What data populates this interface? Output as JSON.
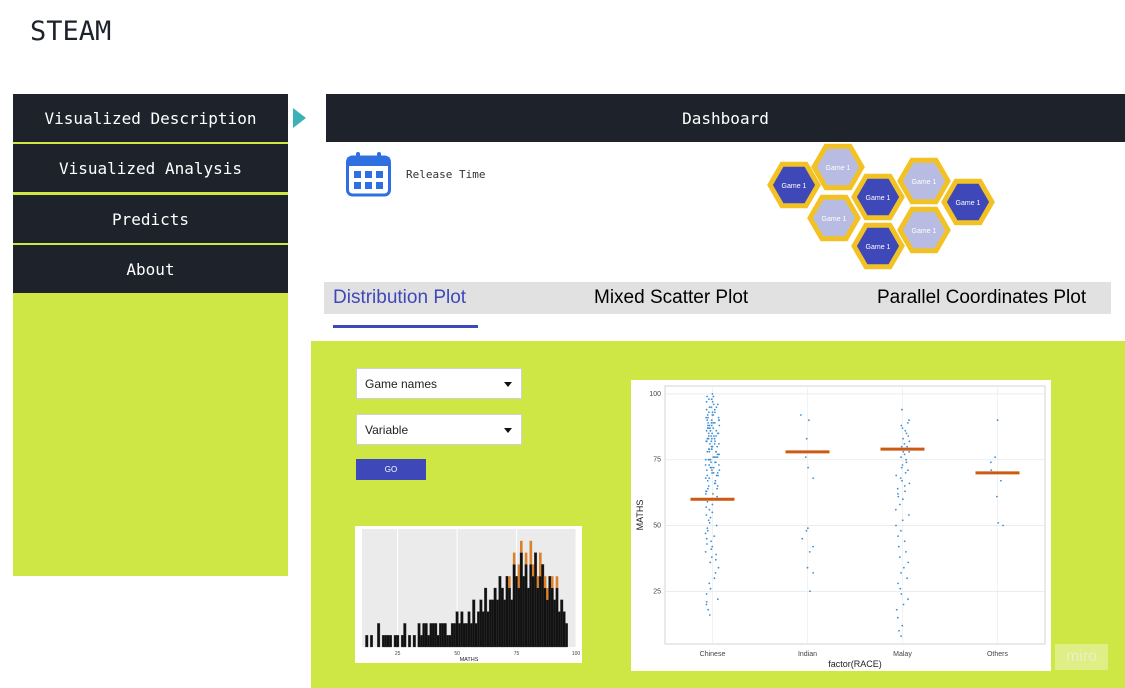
{
  "app": {
    "title": "STEAM"
  },
  "sidebar": {
    "items": [
      {
        "label": "Visualized Description"
      },
      {
        "label": "Visualized Analysis"
      },
      {
        "label": "Predicts"
      },
      {
        "label": "About"
      }
    ]
  },
  "dashboard": {
    "title": "Dashboard",
    "release_label": "Release Time",
    "calendar_icon": "calendar-icon",
    "hex_label": "Game 1",
    "hex_colors": {
      "dark": "#3f48b8",
      "light": "#b8bce2",
      "border": "#f2c225"
    }
  },
  "tabs": [
    {
      "label": "Distribution Plot",
      "active": true
    },
    {
      "label": "Mixed Scatter Plot",
      "active": false
    },
    {
      "label": "Parallel Coordinates Plot",
      "active": false
    }
  ],
  "controls": {
    "game_select": {
      "value": "Game names"
    },
    "variable_select": {
      "value": "Variable"
    },
    "go_label": "GO"
  },
  "watermark": "miro",
  "colors": {
    "accent_green": "#cfe744",
    "nav_dark": "#1e222b",
    "accent_blue": "#3f48b8",
    "arrow_teal": "#3ab2b8"
  },
  "chart_data": [
    {
      "type": "bar",
      "xlabel": "MATHS",
      "xticks": [
        25,
        50,
        75,
        100
      ],
      "xlim": [
        10,
        100
      ],
      "x": [
        12,
        14,
        17,
        19,
        20,
        21,
        22,
        24,
        25,
        27,
        28,
        30,
        32,
        34,
        35,
        36,
        37,
        38,
        39,
        40,
        41,
        42,
        43,
        44,
        45,
        46,
        47,
        48,
        49,
        50,
        51,
        52,
        53,
        54,
        55,
        56,
        57,
        58,
        59,
        60,
        61,
        62,
        63,
        64,
        65,
        66,
        67,
        68,
        69,
        70,
        71,
        72,
        73,
        74,
        75,
        76,
        77,
        78,
        79,
        80,
        81,
        82,
        83,
        84,
        85,
        86,
        87,
        88,
        89,
        90,
        91,
        92,
        93,
        94,
        95,
        96
      ],
      "series": [
        {
          "values": [
            1,
            1,
            2,
            1,
            1,
            1,
            1,
            1,
            1,
            1,
            2,
            1,
            1,
            2,
            1,
            2,
            2,
            1,
            2,
            2,
            2,
            1,
            2,
            2,
            2,
            1,
            1,
            2,
            2,
            3,
            2,
            3,
            2,
            2,
            3,
            2,
            4,
            2,
            3,
            4,
            3,
            5,
            3,
            4,
            4,
            5,
            4,
            6,
            5,
            4,
            6,
            5,
            4,
            7,
            6,
            5,
            8,
            6,
            7,
            5,
            7,
            6,
            8,
            5,
            6,
            7,
            5,
            4,
            6,
            5,
            4,
            5,
            3,
            4,
            3,
            2
          ]
        },
        {
          "values": [
            0,
            0,
            0,
            0,
            0,
            0,
            0,
            0,
            0,
            0,
            0,
            0,
            0,
            0,
            0,
            0,
            0,
            0,
            0,
            0,
            0,
            0,
            0,
            0,
            0,
            0,
            0,
            0,
            0,
            0,
            0,
            0,
            0,
            0,
            0,
            0,
            0,
            0,
            0,
            0,
            0,
            0,
            0,
            0,
            0,
            0,
            0,
            0,
            0,
            0,
            0,
            1,
            0,
            1,
            0,
            2,
            1,
            0,
            1,
            0,
            2,
            1,
            0,
            1,
            2,
            0,
            1,
            1,
            0,
            1,
            0,
            1,
            0,
            0,
            0,
            0
          ]
        }
      ]
    },
    {
      "type": "scatter",
      "xlabel": "factor(RACE)",
      "ylabel": "MATHS",
      "categories": [
        "Chinese",
        "Indian",
        "Malay",
        "Others"
      ],
      "yticks": [
        25,
        50,
        75,
        100
      ],
      "ylim": [
        5,
        103
      ],
      "category_means": [
        60,
        78,
        79,
        70
      ],
      "points": [
        [
          [
            100,
            99,
            99,
            98,
            98,
            97,
            97,
            96,
            96,
            95,
            95,
            95,
            94,
            94,
            93,
            93,
            93,
            92,
            92,
            92,
            91,
            91,
            91,
            90,
            90,
            90,
            90,
            89,
            89,
            89,
            89,
            88,
            88,
            88,
            88,
            87,
            87,
            87,
            87,
            86,
            86,
            86,
            86,
            85,
            85,
            85,
            85,
            84,
            84,
            84,
            84,
            83,
            83,
            83,
            83,
            82,
            82,
            82,
            82,
            81,
            81,
            81,
            80,
            80,
            80,
            80,
            79,
            79,
            79,
            79,
            78,
            78,
            78,
            78,
            77,
            77,
            77,
            76,
            76,
            76,
            76,
            75,
            75,
            75,
            75,
            74,
            74,
            74,
            73,
            73,
            73,
            72,
            72,
            72,
            71,
            71,
            71,
            70,
            70,
            70,
            69,
            69,
            69,
            68,
            68,
            67,
            67,
            66,
            66,
            65,
            65,
            64,
            64,
            63,
            63,
            62,
            62,
            61,
            60,
            59,
            58,
            57,
            56,
            55,
            54,
            53,
            52,
            51,
            50,
            49,
            48,
            47,
            46,
            45,
            44,
            43,
            42,
            41,
            40,
            39,
            38,
            37,
            36,
            34,
            32,
            30,
            28,
            26,
            24,
            22,
            21,
            20,
            18,
            16
          ]
        ],
        [
          [
            92,
            90,
            83,
            76,
            72,
            68,
            49,
            48,
            45,
            42,
            40,
            34,
            32,
            25
          ]
        ],
        [
          [
            94,
            90,
            89,
            88,
            87,
            86,
            85,
            84,
            83,
            82,
            81,
            80,
            80,
            79,
            78,
            78,
            77,
            76,
            75,
            74,
            73,
            72,
            71,
            70,
            69,
            68,
            67,
            66,
            65,
            64,
            63,
            62,
            61,
            60,
            58,
            56,
            54,
            52,
            50,
            48,
            46,
            44,
            42,
            40,
            38,
            36,
            34,
            32,
            30,
            28,
            26,
            24,
            22,
            20,
            18,
            15,
            12,
            10,
            8
          ]
        ],
        [
          [
            90,
            76,
            74,
            71,
            67,
            61,
            51,
            50
          ]
        ]
      ]
    }
  ]
}
